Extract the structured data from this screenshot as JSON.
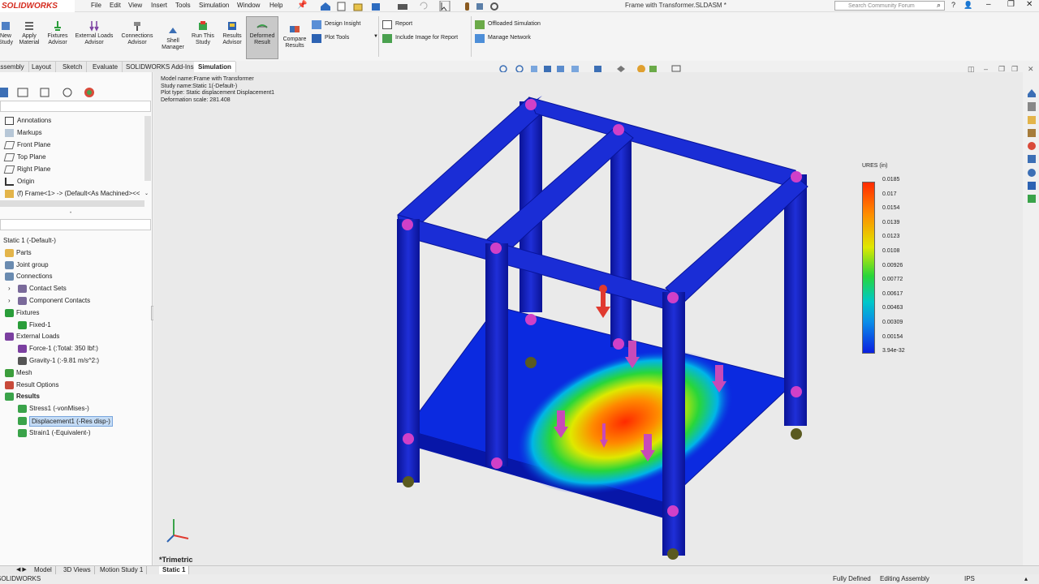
{
  "app": {
    "brand": "SOLIDWORKS",
    "doc_title": "Frame with Transformer.SLDASM *",
    "search_placeholder": "Search Community Forum"
  },
  "menu": [
    "File",
    "Edit",
    "View",
    "Insert",
    "Tools",
    "Simulation",
    "Window",
    "Help"
  ],
  "commands": [
    {
      "label": "New\nStudy",
      "icon": "new-study-icon"
    },
    {
      "label": "Apply\nMaterial",
      "icon": "apply-material-icon"
    },
    {
      "label": "Fixtures\nAdvisor",
      "icon": "fixtures-advisor-icon"
    },
    {
      "label": "External Loads\nAdvisor",
      "icon": "external-loads-icon"
    },
    {
      "label": "Connections\nAdvisor",
      "icon": "connections-icon"
    },
    {
      "label": "Shell\nManager",
      "icon": "shell-manager-icon"
    },
    {
      "label": "Run This\nStudy",
      "icon": "run-study-icon"
    },
    {
      "label": "Results\nAdvisor",
      "icon": "results-advisor-icon"
    },
    {
      "label": "Deformed\nResult",
      "icon": "deformed-result-icon",
      "selected": true
    },
    {
      "label": "Compare\nResults",
      "icon": "compare-results-icon"
    }
  ],
  "side_commands": {
    "design_insight": "Design Insight",
    "plot_tools": "Plot Tools",
    "report": "Report",
    "include_image": "Include Image for Report",
    "offloaded": "Offloaded Simulation",
    "manage_network": "Manage Network"
  },
  "tabs": [
    "Assembly",
    "Layout",
    "Sketch",
    "Evaluate",
    "SOLIDWORKS Add-Ins",
    "Simulation"
  ],
  "active_tab": "Simulation",
  "feature_tree": [
    "Annotations",
    "Markups",
    "Front Plane",
    "Top Plane",
    "Right Plane",
    "Origin",
    "(f) Frame<1> -> (Default<As Machined><<"
  ],
  "study_tree": [
    {
      "label": "Static 1 (-Default-)",
      "indent": 0
    },
    {
      "label": "Parts",
      "indent": 1
    },
    {
      "label": "Joint group",
      "indent": 1
    },
    {
      "label": "Connections",
      "indent": 1
    },
    {
      "label": "Contact Sets",
      "indent": 2
    },
    {
      "label": "Component Contacts",
      "indent": 2
    },
    {
      "label": "Fixtures",
      "indent": 1
    },
    {
      "label": "Fixed-1",
      "indent": 2
    },
    {
      "label": "External Loads",
      "indent": 1
    },
    {
      "label": "Force-1 (:Total: 350 lbf:)",
      "indent": 2
    },
    {
      "label": "Gravity-1 (:-9.81 m/s^2:)",
      "indent": 2
    },
    {
      "label": "Mesh",
      "indent": 1
    },
    {
      "label": "Result Options",
      "indent": 1
    },
    {
      "label": "Results",
      "indent": 1,
      "bold": true
    },
    {
      "label": "Stress1 (-vonMises-)",
      "indent": 2
    },
    {
      "label": "Displacement1 (-Res disp-)",
      "indent": 2,
      "selected": true
    },
    {
      "label": "Strain1 (-Equivalent-)",
      "indent": 2
    }
  ],
  "plot_info": {
    "model": "Model name:Frame with Transformer",
    "study": "Study name:Static 1(-Default-)",
    "plot_type": "Plot type: Static displacement Displacement1",
    "scale": "Deformation scale: 281.408"
  },
  "legend": {
    "title": "URES (in)",
    "values": [
      "0.0185",
      "0.017",
      "0.0154",
      "0.0139",
      "0.0123",
      "0.0108",
      "0.00926",
      "0.00772",
      "0.00617",
      "0.00463",
      "0.00309",
      "0.00154",
      "3.94e-32"
    ]
  },
  "view_label": "*Trimetric",
  "bottom_tabs": [
    "Model",
    "3D Views",
    "Motion Study 1",
    "Static 1"
  ],
  "status": {
    "app": "SOLIDWORKS",
    "defined": "Fully Defined",
    "mode": "Editing Assembly",
    "units": "IPS"
  }
}
